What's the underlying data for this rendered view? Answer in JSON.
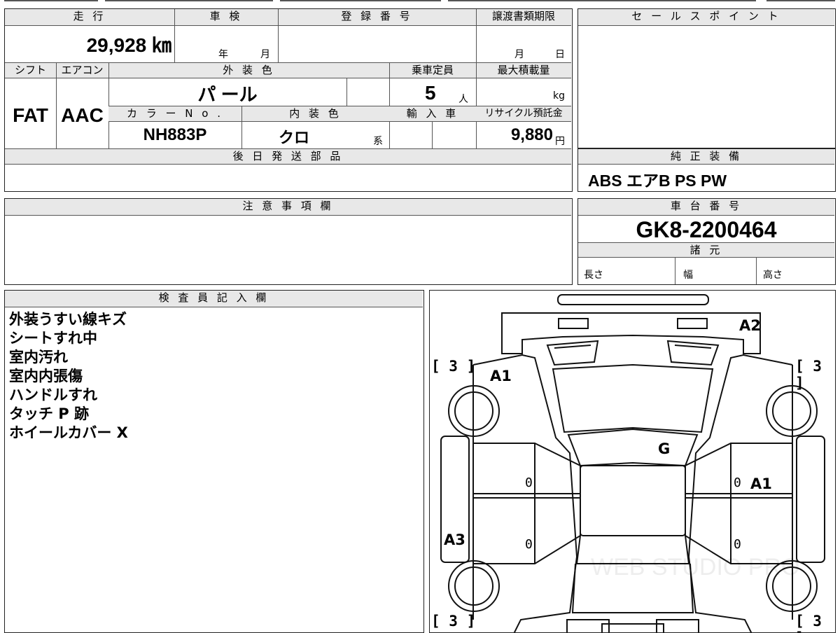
{
  "vehicle": {
    "mileage_label": "走 行",
    "mileage_value": "29,928 ㎞",
    "shaken_label": "車 検",
    "shaken_year_unit": "年",
    "shaken_month_unit": "月",
    "registration_label": "登 録 番 号",
    "transfer_deadline_label": "譲渡書類期限",
    "transfer_month_unit": "月",
    "transfer_day_unit": "日",
    "shift_label": "シフト",
    "shift_value": "FAT",
    "ac_label": "エアコン",
    "ac_value": "AAC",
    "exterior_color_label": "外 装 色",
    "exterior_color_value": "パ ール",
    "capacity_label": "乗車定員",
    "capacity_value": "5",
    "capacity_unit": "人",
    "max_load_label": "最大積載量",
    "max_load_unit": "kg",
    "color_no_label": "カ ラ ー N o .",
    "color_no_value": "NH883P",
    "interior_color_label": "内 装 色",
    "interior_color_value": "クロ",
    "interior_color_suffix": "系",
    "import_label": "輸 入 車",
    "recycle_label": "リサイクル預託金",
    "recycle_value": "9,880",
    "recycle_unit": "円"
  },
  "later_parts": {
    "label": "後 日 発 送 部 品"
  },
  "sales_point": {
    "label": "セ ー ル ス ポ イ ン ト"
  },
  "equipment": {
    "label": "純 正 装 備",
    "value": "ABS エアB PS PW"
  },
  "notes": {
    "label": "注 意 事 項 欄"
  },
  "chassis": {
    "label": "車 台 番 号",
    "value": "GK8-2200464"
  },
  "specs": {
    "label": "諸 元",
    "length": "長さ",
    "width": "幅",
    "height": "高さ"
  },
  "inspector": {
    "label": "検 査 員 記 入 欄",
    "comments": [
      "外装うすい線キズ",
      "シートすれ中",
      "室内汚れ",
      "室内内張傷",
      "ハンドルすれ",
      "タッチ P 跡",
      "ホイールカバー X"
    ]
  },
  "diagram": {
    "marks": {
      "a2": "A2",
      "a1_left": "A1",
      "g": "G",
      "a1_right": "A1",
      "a3": "A3"
    },
    "tire_depth": {
      "fl": "3",
      "fr": "3",
      "rl": "3",
      "rr": "3"
    },
    "zeros": {
      "z1": "0",
      "z2": "0",
      "z3": "0",
      "z4": "0"
    }
  },
  "watermark": "WEB STUDIO PRO"
}
